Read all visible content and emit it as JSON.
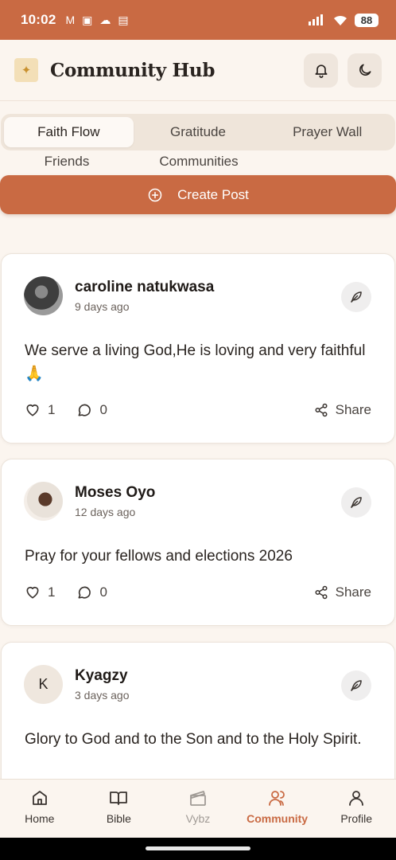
{
  "status_bar": {
    "time": "10:02",
    "battery": "88"
  },
  "header": {
    "title": "Community Hub"
  },
  "tabs": [
    {
      "label": "Faith Flow",
      "active": true
    },
    {
      "label": "Gratitude",
      "active": false
    },
    {
      "label": "Prayer Wall",
      "active": false
    }
  ],
  "tabs_row2": [
    {
      "label": "Friends"
    },
    {
      "label": "Communities"
    }
  ],
  "create_post": {
    "label": "Create Post"
  },
  "posts": [
    {
      "author": "caroline natukwasa",
      "time": "9 days ago",
      "body": "We serve a living God,He is loving and very faithful 🙏",
      "likes": "1",
      "comments": "0",
      "share": "Share",
      "avatar": "photo"
    },
    {
      "author": "Moses Oyo",
      "time": "12 days ago",
      "body": "Pray for your fellows and elections 2026",
      "likes": "1",
      "comments": "0",
      "share": "Share",
      "avatar": "photo"
    },
    {
      "author": "Kyagzy",
      "time": "3 days ago",
      "body": "Glory to God and to the Son and to the Holy Spirit.",
      "initial": "K",
      "avatar": "initial"
    }
  ],
  "bottom_nav": [
    {
      "label": "Home",
      "icon": "home-icon"
    },
    {
      "label": "Bible",
      "icon": "book-icon"
    },
    {
      "label": "Vybz",
      "icon": "clapperboard-icon"
    },
    {
      "label": "Community",
      "icon": "users-icon",
      "active": true
    },
    {
      "label": "Profile",
      "icon": "user-icon"
    }
  ],
  "colors": {
    "accent": "#c96a43",
    "background": "#fbf5ef"
  }
}
